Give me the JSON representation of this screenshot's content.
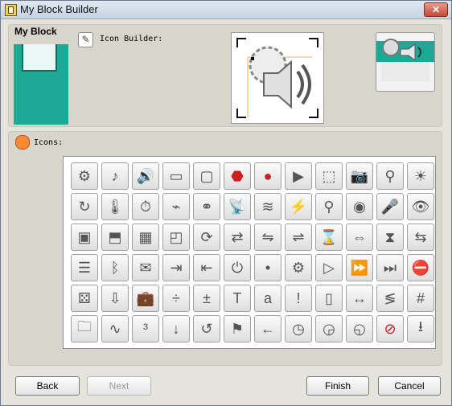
{
  "window": {
    "title": "My Block Builder",
    "close_label": "✕"
  },
  "left": {
    "label": "My Block"
  },
  "builder": {
    "label": "Icon Builder:"
  },
  "icons": {
    "label": "Icons:",
    "rows": [
      [
        "gear-icon",
        "note-icon",
        "speaker-icon",
        "flashlight-icon",
        "monitor-icon",
        "stop-sign-icon",
        "red-circle-icon",
        "play-icon",
        "box-icon",
        "camera-icon",
        "faucet-icon",
        "sun-icon"
      ],
      [
        "rotate-question-icon",
        "thermometer-icon",
        "stopwatch-icon",
        "sensor-icon",
        "sensor2-icon",
        "sound-sensor-icon",
        "waveform-icon",
        "antenna-icon",
        "radar-icon",
        "dial-icon",
        "microphone-icon",
        "eye-icon"
      ],
      [
        "blocks-icon",
        "pieces-icon",
        "stack-icon",
        "cube-icon",
        "refresh-icon",
        "split-icon",
        "connector-icon",
        "connector2-icon",
        "hourglass-icon",
        "connector3-icon",
        "hourglass2-icon",
        "connector4-icon"
      ],
      [
        "list-icon",
        "bluetooth-icon",
        "envelope-icon",
        "bluetooth-arrow-icon",
        "bluetooth-arrow2-icon",
        "power-icon",
        "dot-icon",
        "gears-icon",
        "play-gear-icon",
        "fast-forward-gear-icon",
        "forward-gear-icon",
        "stop-gear-icon"
      ],
      [
        "dice-icon",
        "download-icon",
        "briefcase-icon",
        "divide-icon",
        "math-icon",
        "text-icon",
        "quote-a-icon",
        "quote-bang-icon",
        "battery-icon",
        "range-icon",
        "compare-icon",
        "counter-icon"
      ],
      [
        "folder-icon",
        "signal-icon",
        "exponent-icon",
        "down-arrow-icon",
        "rotate-icon",
        "flag-icon",
        "left-arrow-icon",
        "clock-icon",
        "clock2-icon",
        "clock3-icon",
        "no-icon",
        "save-icon"
      ]
    ],
    "glyphs": {
      "gear-icon": "⚙",
      "note-icon": "♪",
      "speaker-icon": "🔊",
      "flashlight-icon": "▭",
      "monitor-icon": "▢",
      "stop-sign-icon": "⬣",
      "red-circle-icon": "●",
      "play-icon": "▶",
      "box-icon": "⬚",
      "camera-icon": "📷",
      "faucet-icon": "⚲",
      "sun-icon": "☀",
      "rotate-question-icon": "↻",
      "thermometer-icon": "🌡",
      "stopwatch-icon": "⏱",
      "sensor-icon": "⌁",
      "sensor2-icon": "⚭",
      "sound-sensor-icon": "📡",
      "waveform-icon": "≋",
      "antenna-icon": "⚡",
      "radar-icon": "⚲",
      "dial-icon": "◉",
      "microphone-icon": "🎤",
      "eye-icon": "👁",
      "blocks-icon": "▣",
      "pieces-icon": "⬒",
      "stack-icon": "▦",
      "cube-icon": "◰",
      "refresh-icon": "⟳",
      "split-icon": "⇄",
      "connector-icon": "⇋",
      "connector2-icon": "⇌",
      "hourglass-icon": "⌛",
      "connector3-icon": "⇔",
      "hourglass2-icon": "⧗",
      "connector4-icon": "⇆",
      "list-icon": "☰",
      "bluetooth-icon": "ᛒ",
      "envelope-icon": "✉",
      "bluetooth-arrow-icon": "⇥",
      "bluetooth-arrow2-icon": "⇤",
      "power-icon": "⏻",
      "dot-icon": "•",
      "gears-icon": "⚙",
      "play-gear-icon": "▷",
      "fast-forward-gear-icon": "⏩",
      "forward-gear-icon": "⏭",
      "stop-gear-icon": "⛔",
      "dice-icon": "⚄",
      "download-icon": "⇩",
      "briefcase-icon": "💼",
      "divide-icon": "÷",
      "math-icon": "±",
      "text-icon": "T",
      "quote-a-icon": "a",
      "quote-bang-icon": "!",
      "battery-icon": "▯",
      "range-icon": "↔",
      "compare-icon": "≶",
      "counter-icon": "#",
      "folder-icon": "🗀",
      "signal-icon": "∿",
      "exponent-icon": "³",
      "down-arrow-icon": "↓",
      "rotate-icon": "↺",
      "flag-icon": "⚑",
      "left-arrow-icon": "←",
      "clock-icon": "◷",
      "clock2-icon": "◶",
      "clock3-icon": "◵",
      "no-icon": "⊘",
      "save-icon": "⭳"
    }
  },
  "footer": {
    "back": "Back",
    "next": "Next",
    "finish": "Finish",
    "cancel": "Cancel"
  }
}
